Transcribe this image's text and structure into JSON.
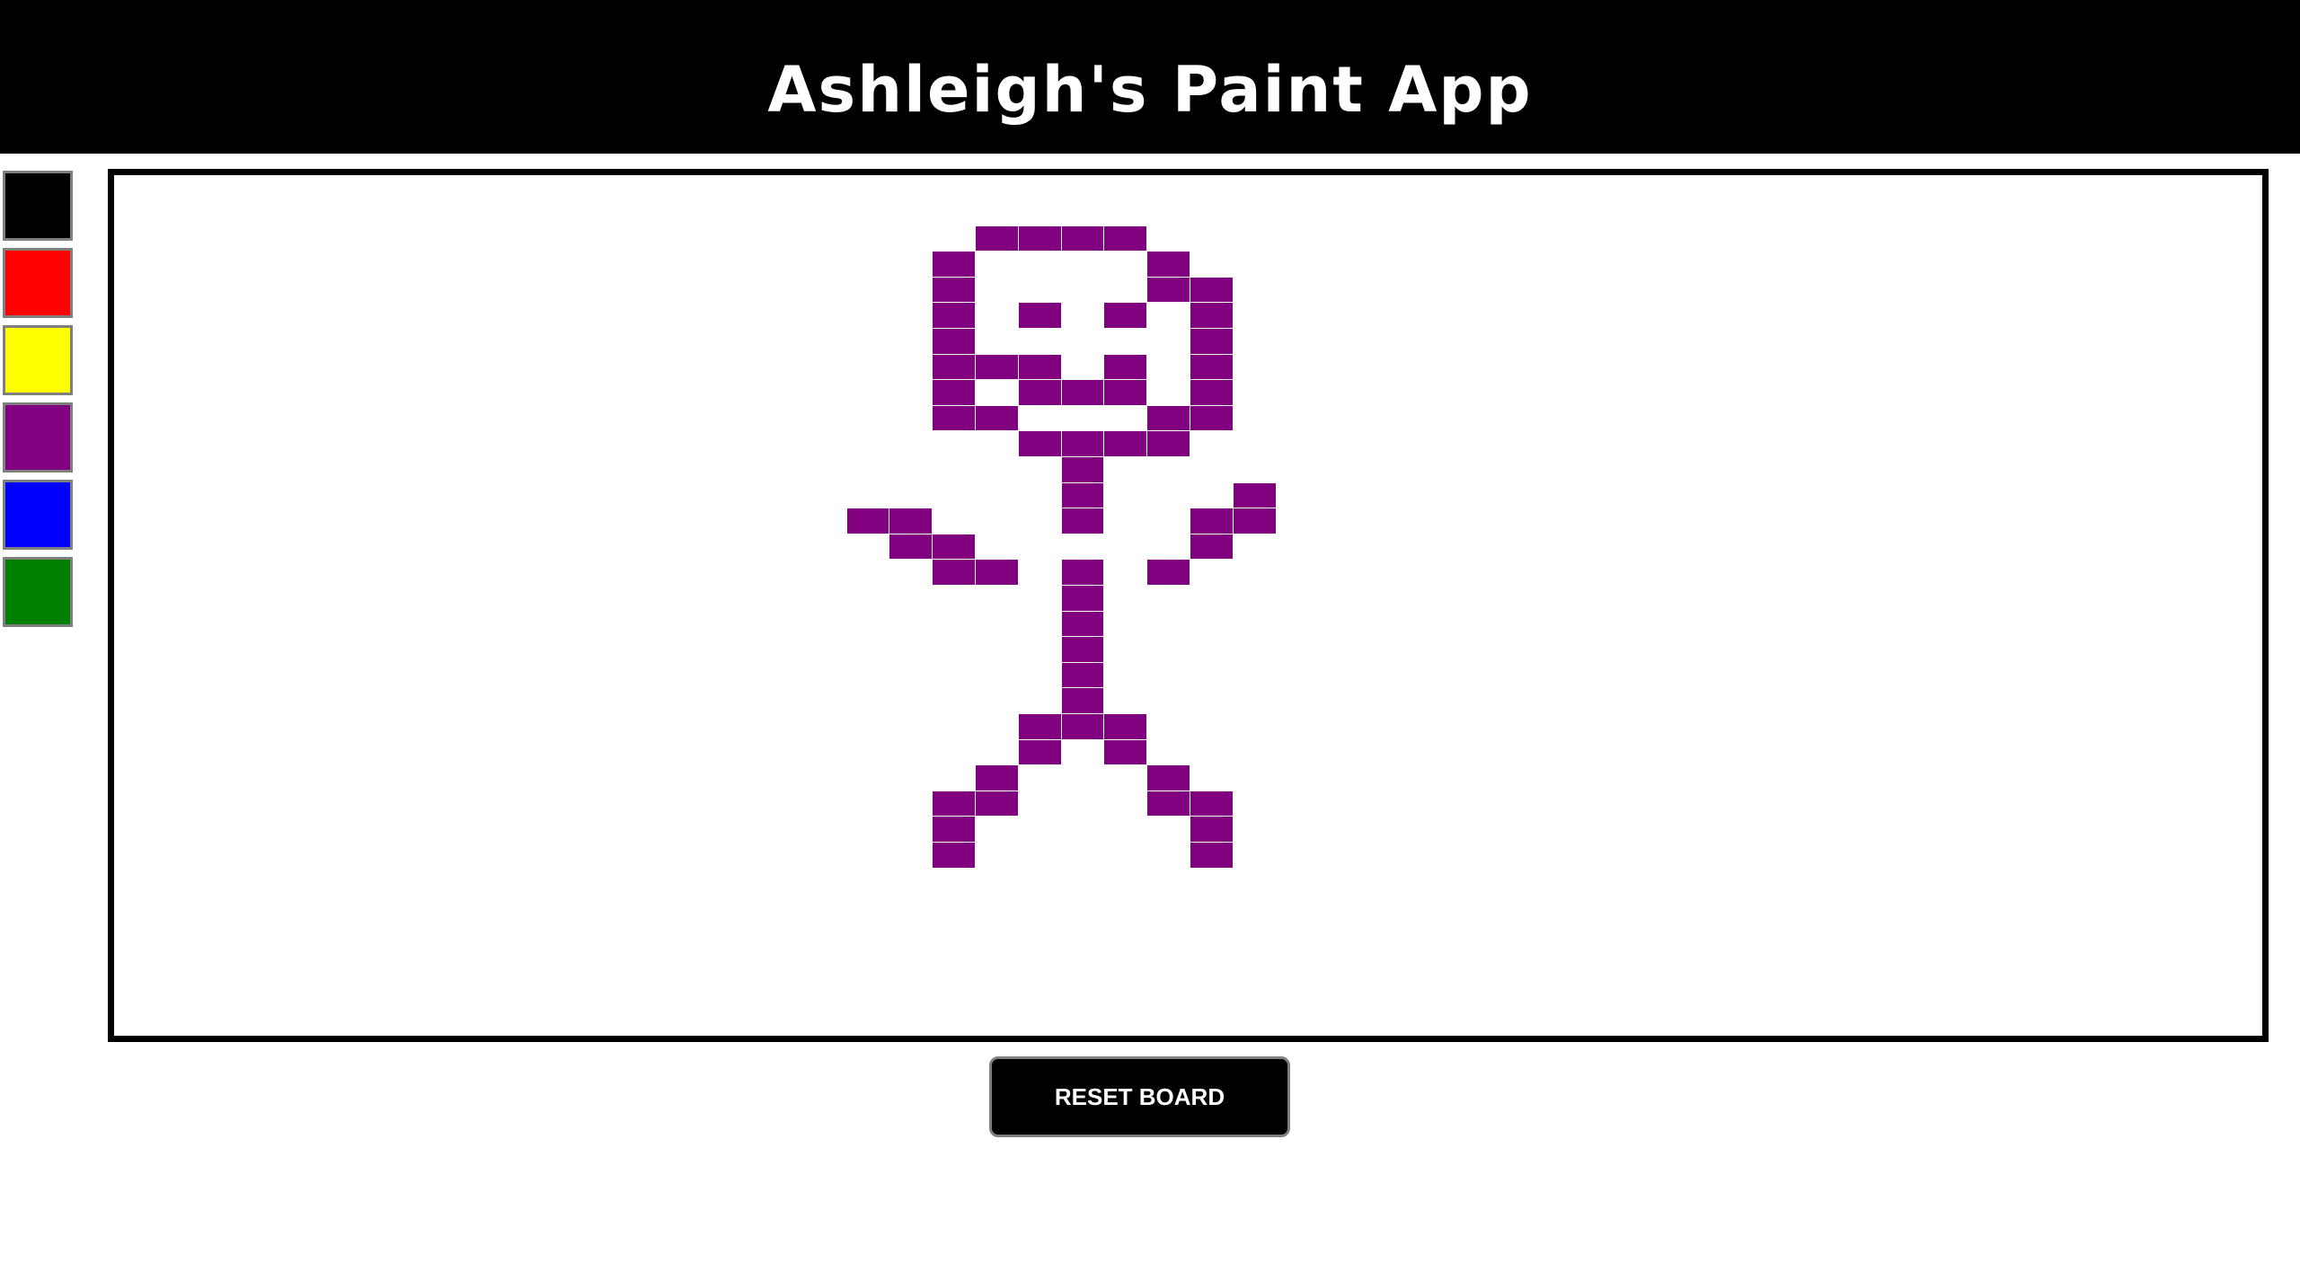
{
  "app": {
    "title": "Ashleigh's Paint App"
  },
  "palette": {
    "colors": [
      {
        "name": "black",
        "hex": "#000000"
      },
      {
        "name": "red",
        "hex": "#ff0000"
      },
      {
        "name": "yellow",
        "hex": "#ffff00"
      },
      {
        "name": "purple",
        "hex": "#800080"
      },
      {
        "name": "blue",
        "hex": "#0000ff"
      },
      {
        "name": "green",
        "hex": "#008000"
      }
    ]
  },
  "board": {
    "rows": 33,
    "cols": 50,
    "painted_color": "#800080",
    "painted_cells": [
      [
        1,
        20
      ],
      [
        1,
        21
      ],
      [
        1,
        22
      ],
      [
        1,
        23
      ],
      [
        2,
        19
      ],
      [
        2,
        24
      ],
      [
        3,
        19
      ],
      [
        3,
        24
      ],
      [
        3,
        25
      ],
      [
        4,
        19
      ],
      [
        4,
        21
      ],
      [
        4,
        23
      ],
      [
        4,
        25
      ],
      [
        5,
        19
      ],
      [
        5,
        25
      ],
      [
        6,
        19
      ],
      [
        6,
        20
      ],
      [
        6,
        21
      ],
      [
        6,
        23
      ],
      [
        6,
        25
      ],
      [
        7,
        19
      ],
      [
        7,
        21
      ],
      [
        7,
        22
      ],
      [
        7,
        23
      ],
      [
        7,
        25
      ],
      [
        8,
        19
      ],
      [
        8,
        20
      ],
      [
        8,
        24
      ],
      [
        8,
        25
      ],
      [
        9,
        21
      ],
      [
        9,
        22
      ],
      [
        9,
        23
      ],
      [
        9,
        24
      ],
      [
        10,
        22
      ],
      [
        11,
        22
      ],
      [
        11,
        26
      ],
      [
        12,
        17
      ],
      [
        12,
        18
      ],
      [
        12,
        22
      ],
      [
        12,
        25
      ],
      [
        12,
        26
      ],
      [
        13,
        18
      ],
      [
        13,
        19
      ],
      [
        13,
        25
      ],
      [
        14,
        19
      ],
      [
        14,
        20
      ],
      [
        14,
        22
      ],
      [
        14,
        24
      ],
      [
        15,
        22
      ],
      [
        16,
        22
      ],
      [
        17,
        22
      ],
      [
        18,
        22
      ],
      [
        19,
        22
      ],
      [
        20,
        21
      ],
      [
        20,
        22
      ],
      [
        20,
        23
      ],
      [
        21,
        21
      ],
      [
        21,
        23
      ],
      [
        22,
        20
      ],
      [
        22,
        24
      ],
      [
        23,
        19
      ],
      [
        23,
        20
      ],
      [
        23,
        24
      ],
      [
        23,
        25
      ],
      [
        24,
        19
      ],
      [
        24,
        25
      ],
      [
        25,
        19
      ],
      [
        25,
        25
      ]
    ]
  },
  "controls": {
    "reset_label": "RESET BOARD"
  }
}
